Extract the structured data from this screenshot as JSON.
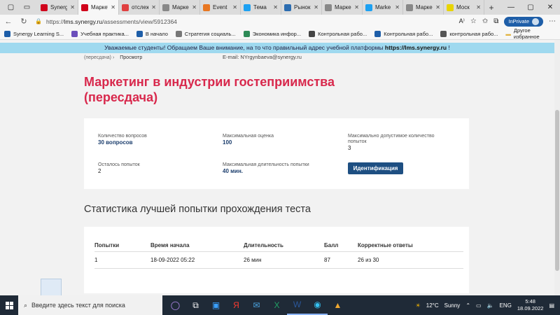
{
  "browser": {
    "tabs": [
      {
        "title": "Synergy",
        "color": "#d0021b",
        "active": false
      },
      {
        "title": "Маркет",
        "color": "#d0021b",
        "active": true
      },
      {
        "title": "отслеж",
        "color": "#e04040",
        "active": false
      },
      {
        "title": "Марке",
        "color": "#888888",
        "active": false
      },
      {
        "title": "Event",
        "color": "#e87722",
        "active": false
      },
      {
        "title": "Тема",
        "color": "#1da1f2",
        "active": false
      },
      {
        "title": "Рынок",
        "color": "#2b6cb0",
        "active": false
      },
      {
        "title": "Марке",
        "color": "#888888",
        "active": false
      },
      {
        "title": "Marke",
        "color": "#1da1f2",
        "active": false
      },
      {
        "title": "Марке",
        "color": "#888888",
        "active": false
      },
      {
        "title": "Моск",
        "color": "#e8d400",
        "active": false
      }
    ],
    "url_prefix": "https://",
    "url_host": "lms.synergy.ru",
    "url_path": "/assessments/view/5912364",
    "inprivate_label": "InPrivate",
    "bookmarks": [
      {
        "label": "Synergy Learning S...",
        "color": "#1e5ea8"
      },
      {
        "label": "Учебная практика...",
        "color": "#6b4fbb"
      },
      {
        "label": "В начало",
        "color": "#1e5ea8"
      },
      {
        "label": "Стратегия социаль...",
        "color": "#777777"
      },
      {
        "label": "Экономика инфор...",
        "color": "#2e8b57"
      },
      {
        "label": "Контрольная рабо...",
        "color": "#444444"
      },
      {
        "label": "Контрольная рабо...",
        "color": "#1e5ea8"
      },
      {
        "label": "контрольная рабо...",
        "color": "#555555"
      }
    ],
    "other_bookmarks": "Другое избранное"
  },
  "notice": {
    "text": "Уважаемые студенты! Обращаем Ваше внимание, на то что правильный адрес учебной платформы",
    "link": "https://lms.synergy.ru",
    "tail": "!"
  },
  "page": {
    "breadcrumb_prev": "(пересдача)",
    "breadcrumb_current": "Просмотр",
    "email": "E-mail: NYrgynbaeva@synergy.ru",
    "title": "Маркетинг в индустрии гостеприимства (пересдача)",
    "info": {
      "questions_label": "Количество вопросов",
      "questions_value": "30 вопросов",
      "max_score_label": "Максимальная оценка",
      "max_score_value": "100",
      "max_attempts_label": "Максимально допустимое количество попыток",
      "max_attempts_value": "3",
      "attempts_left_label": "Осталось попыток",
      "attempts_left_value": "2",
      "max_duration_label": "Максимальная длительность попытки",
      "max_duration_value": "40 мин.",
      "ident_button": "Идентификация"
    },
    "stats_title": "Статистика лучшей попытки прохождения теста",
    "table": {
      "headers": [
        "Попытки",
        "Время начала",
        "Длительность",
        "Балл",
        "Корректные ответы"
      ],
      "rows": [
        [
          "1",
          "18-09-2022 05:22",
          "26 мин",
          "87",
          "26 из 30"
        ]
      ]
    }
  },
  "taskbar": {
    "search_placeholder": "Введите здесь текст для поиска",
    "weather_temp": "12°C",
    "weather_text": "Sunny",
    "lang": "ENG",
    "time": "5:48",
    "date": "18.09.2022"
  }
}
